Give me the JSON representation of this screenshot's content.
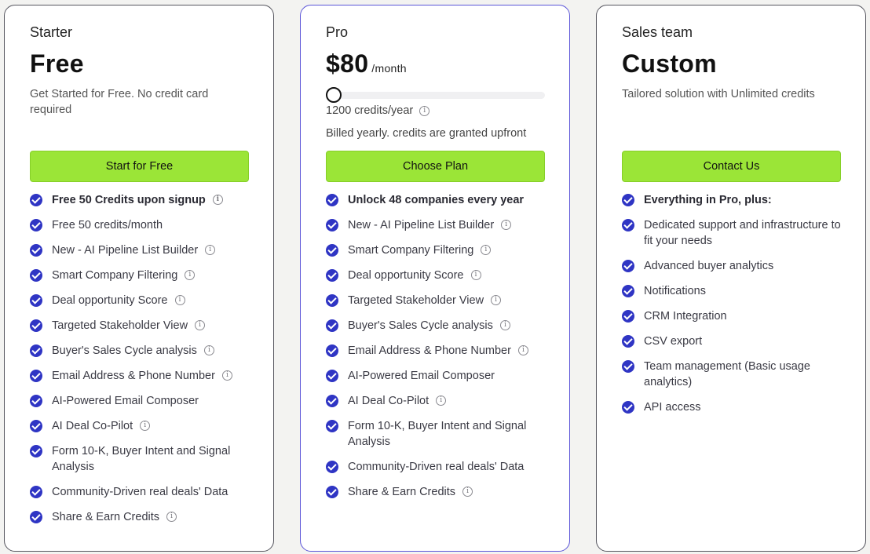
{
  "colors": {
    "cta": "#9be537",
    "check": "#2f35c4",
    "pro_border": "#5b55d8"
  },
  "icons": {
    "check": "check-circle-icon",
    "info": "info-icon"
  },
  "starter": {
    "tier": "Starter",
    "price": "Free",
    "description": "Get Started for Free. No credit card required",
    "cta": "Start for Free",
    "features": [
      {
        "text": "Free 50 Credits upon signup",
        "bold": true,
        "info": true
      },
      {
        "text": "Free 50 credits/month",
        "bold": false,
        "info": false
      },
      {
        "text": "New - AI Pipeline List Builder",
        "bold": false,
        "info": true
      },
      {
        "text": "Smart Company Filtering",
        "bold": false,
        "info": true
      },
      {
        "text": "Deal opportunity Score",
        "bold": false,
        "info": true
      },
      {
        "text": "Targeted Stakeholder View",
        "bold": false,
        "info": true
      },
      {
        "text": "Buyer's Sales Cycle analysis",
        "bold": false,
        "info": true
      },
      {
        "text": "Email Address & Phone Number",
        "bold": false,
        "info": true
      },
      {
        "text": "AI-Powered Email Composer",
        "bold": false,
        "info": false
      },
      {
        "text": "AI Deal Co-Pilot",
        "bold": false,
        "info": true
      },
      {
        "text": "Form 10-K, Buyer Intent and Signal Analysis",
        "bold": false,
        "info": false
      },
      {
        "text": "Community-Driven real deals' Data",
        "bold": false,
        "info": false
      },
      {
        "text": "Share & Earn Credits",
        "bold": false,
        "info": true
      }
    ]
  },
  "pro": {
    "tier": "Pro",
    "price": "$80",
    "period": "/month",
    "slider_fraction": 0,
    "credits": "1200 credits/year",
    "billing": "Billed yearly. credits are granted upfront",
    "cta": "Choose Plan",
    "features": [
      {
        "text": "Unlock 48 companies every year",
        "bold": true,
        "info": false
      },
      {
        "text": "New - AI Pipeline List Builder",
        "bold": false,
        "info": true
      },
      {
        "text": "Smart Company Filtering",
        "bold": false,
        "info": true
      },
      {
        "text": "Deal opportunity Score",
        "bold": false,
        "info": true
      },
      {
        "text": "Targeted Stakeholder View",
        "bold": false,
        "info": true
      },
      {
        "text": "Buyer's Sales Cycle analysis",
        "bold": false,
        "info": true
      },
      {
        "text": "Email Address & Phone Number",
        "bold": false,
        "info": true
      },
      {
        "text": "AI-Powered Email Composer",
        "bold": false,
        "info": false
      },
      {
        "text": "AI Deal Co-Pilot",
        "bold": false,
        "info": true
      },
      {
        "text": "Form 10-K, Buyer Intent and Signal Analysis",
        "bold": false,
        "info": false
      },
      {
        "text": "Community-Driven real deals' Data",
        "bold": false,
        "info": false
      },
      {
        "text": "Share & Earn Credits",
        "bold": false,
        "info": true
      }
    ]
  },
  "sales": {
    "tier": "Sales team",
    "price": "Custom",
    "description": "Tailored solution with Unlimited credits",
    "cta": "Contact Us",
    "features": [
      {
        "text": "Everything in Pro, plus:",
        "bold": true,
        "info": false
      },
      {
        "text": "Dedicated support and infrastructure to fit your needs",
        "bold": false,
        "info": false
      },
      {
        "text": "Advanced buyer analytics",
        "bold": false,
        "info": false
      },
      {
        "text": "Notifications",
        "bold": false,
        "info": false
      },
      {
        "text": "CRM Integration",
        "bold": false,
        "info": false
      },
      {
        "text": "CSV export",
        "bold": false,
        "info": false
      },
      {
        "text": "Team management (Basic usage analytics)",
        "bold": false,
        "info": false
      },
      {
        "text": "API access",
        "bold": false,
        "info": false
      }
    ]
  }
}
